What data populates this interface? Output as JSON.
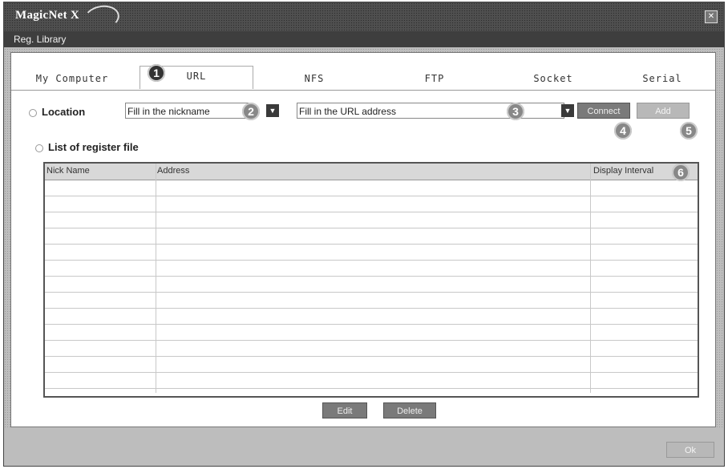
{
  "window": {
    "brand": "MagicNet X",
    "subtitle": "Reg. Library"
  },
  "tabs": [
    {
      "label": "My Computer"
    },
    {
      "label": "URL"
    },
    {
      "label": "NFS"
    },
    {
      "label": "FTP"
    },
    {
      "label": "Socket"
    },
    {
      "label": "Serial"
    }
  ],
  "location": {
    "label": "Location",
    "nickname_placeholder": "Fill in the nickname",
    "url_placeholder": "Fill in the URL address",
    "connect_label": "Connect",
    "add_label": "Add"
  },
  "list": {
    "label": "List of register file",
    "columns": [
      "Nick Name",
      "Address",
      "Display Interval"
    ],
    "rows": []
  },
  "actions": {
    "edit_label": "Edit",
    "delete_label": "Delete",
    "ok_label": "Ok"
  },
  "markers": [
    "1",
    "2",
    "3",
    "4",
    "5",
    "6"
  ]
}
